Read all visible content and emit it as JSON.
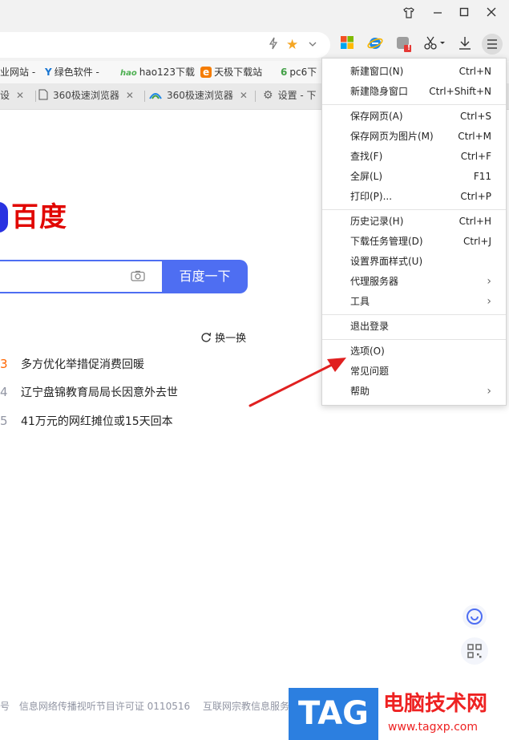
{
  "window": {
    "skin_icon": "tshirt-icon",
    "minimize_icon": "minimize-icon",
    "maximize_icon": "maximize-icon",
    "close_icon": "close-icon"
  },
  "toolbar": {
    "extensions": [
      "microsoft-icon",
      "ie-icon",
      "extension-icon",
      "scissors-icon",
      "download-icon",
      "menu-icon"
    ],
    "badge": "!"
  },
  "bookmarks": [
    {
      "label": "业网站 -"
    },
    {
      "label": "绿色软件 -",
      "glyph": "Y"
    },
    {
      "label": "hao123下载",
      "glyph": "hao"
    },
    {
      "label": "天极下载站",
      "glyph": "e"
    },
    {
      "label": "pc6下",
      "glyph": "6"
    }
  ],
  "tabs": [
    {
      "label": "设"
    },
    {
      "label": "360极速浏览器"
    },
    {
      "label": "360极速浏览器"
    },
    {
      "label": "设置 - 下"
    }
  ],
  "baidu": {
    "logo_text": "百度",
    "search_button": "百度一下",
    "refresh_label": "换一换",
    "hot": [
      {
        "rank": "3",
        "title": "多方优化举措促消费回暖"
      },
      {
        "rank": "4",
        "title": "辽宁盘锦教育局局长因意外去世"
      },
      {
        "rank": "5",
        "title": "41万元的网红摊位或15天回本"
      }
    ],
    "footer": [
      "号",
      "信息网络传播视听节目许可证 0110516",
      "互联网宗教信息服务许"
    ]
  },
  "menu": {
    "groups": [
      [
        {
          "label": "新建窗口(N)",
          "shortcut": "Ctrl+N"
        },
        {
          "label": "新建隐身窗口",
          "shortcut": "Ctrl+Shift+N"
        }
      ],
      [
        {
          "label": "保存网页(A)",
          "shortcut": "Ctrl+S"
        },
        {
          "label": "保存网页为图片(M)",
          "shortcut": "Ctrl+M"
        },
        {
          "label": "查找(F)",
          "shortcut": "Ctrl+F"
        },
        {
          "label": "全屏(L)",
          "shortcut": "F11"
        },
        {
          "label": "打印(P)...",
          "shortcut": "Ctrl+P"
        }
      ],
      [
        {
          "label": "历史记录(H)",
          "shortcut": "Ctrl+H"
        },
        {
          "label": "下载任务管理(D)",
          "shortcut": "Ctrl+J"
        },
        {
          "label": "设置界面样式(U)",
          "shortcut": ""
        },
        {
          "label": "代理服务器",
          "shortcut": "",
          "submenu": true
        },
        {
          "label": "工具",
          "shortcut": "",
          "submenu": true
        }
      ],
      [
        {
          "label": "退出登录",
          "shortcut": ""
        }
      ],
      [
        {
          "label": "选项(O)",
          "shortcut": ""
        },
        {
          "label": "常见问题",
          "shortcut": ""
        },
        {
          "label": "帮助",
          "shortcut": "",
          "submenu": true
        }
      ]
    ],
    "submenu_arrow": "›"
  },
  "watermark": {
    "tag": "TAG",
    "site_name": "电脑技术网",
    "url": "www.tagxp.com"
  },
  "colors": {
    "baidu_blue": "#4e6ef2",
    "baidu_red": "#e10601",
    "arrow_red": "#e02020"
  }
}
